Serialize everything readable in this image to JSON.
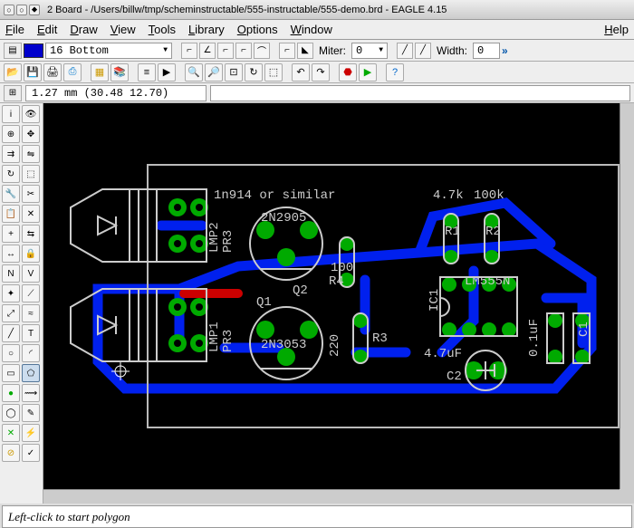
{
  "titlebar": {
    "title": "2 Board - /Users/billw/tmp/scheminstructable/555-instructable/555-demo.brd - EAGLE 4.15"
  },
  "menubar": {
    "file": "File",
    "edit": "Edit",
    "draw": "Draw",
    "view": "View",
    "tools": "Tools",
    "library": "Library",
    "options": "Options",
    "window": "Window",
    "help": "Help"
  },
  "paramrow": {
    "layer": "16 Bottom",
    "miter_label": "Miter:",
    "miter_value": "0",
    "width_label": "Width:",
    "width_value": "0"
  },
  "coord": {
    "text": "1.27 mm (30.48 12.70)"
  },
  "status": {
    "text": "Left-click to start polygon"
  },
  "pcb": {
    "labels": {
      "diode": "1n914 or similar",
      "q1": "Q1",
      "q1part": "2N3053",
      "q2": "Q2",
      "q2part": "2N2905",
      "r1": "R1",
      "r1val": "4.7k",
      "r2": "R2",
      "r2val": "100k",
      "r3": "R3",
      "r3val": "220",
      "r4": "R4",
      "r4val": "100",
      "c1": "C1",
      "c1val": "0.1uF",
      "c2": "C2",
      "c2val": "4.7uF",
      "ic1": "IC1",
      "ic1part": "LM555N",
      "lmp1": "LMP1",
      "lmp2": "LMP2",
      "pr3a": "PR3",
      "pr3b": "PR3"
    }
  }
}
